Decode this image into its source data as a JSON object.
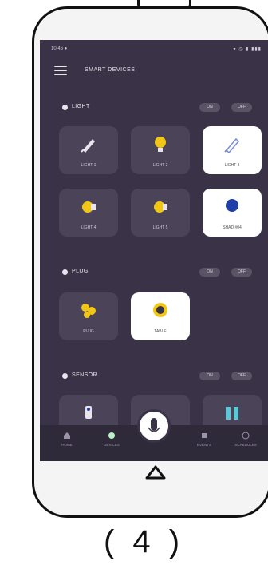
{
  "status_bar": {
    "time": "10:45 ●",
    "icons": "▾ ◷ ▮ ▮▮▮"
  },
  "header": {
    "title": "SMART DEVICES"
  },
  "sections": {
    "light": {
      "label": "LIGHT",
      "on": "ON",
      "off": "OFF"
    },
    "plug": {
      "label": "PLUG",
      "on": "ON",
      "off": "OFF"
    },
    "sensor": {
      "label": "SENSOR",
      "on": "ON",
      "off": "OFF"
    }
  },
  "light_tiles": [
    {
      "label": "LIGHT 1"
    },
    {
      "label": "LIGHT 2"
    },
    {
      "label": "LIGHT 3"
    },
    {
      "label": "LIGHT 4"
    },
    {
      "label": "LIGHT 5"
    },
    {
      "label": "SHAD #04"
    }
  ],
  "plug_tiles": [
    {
      "label": "PLUG"
    },
    {
      "label": "TABLE"
    }
  ],
  "bottom_nav": {
    "items": [
      {
        "label": "HOME"
      },
      {
        "label": "DEVICES"
      },
      {
        "label": "EVENTS"
      },
      {
        "label": "SCHEDULES"
      }
    ]
  },
  "caption": "( 4 )",
  "colors": {
    "screen_bg": "#3a3347",
    "tile_bg": "#4b4458",
    "tile_active": "#ffffff",
    "accent_yellow": "#f2c614",
    "accent_blue": "#1f3fa6"
  }
}
